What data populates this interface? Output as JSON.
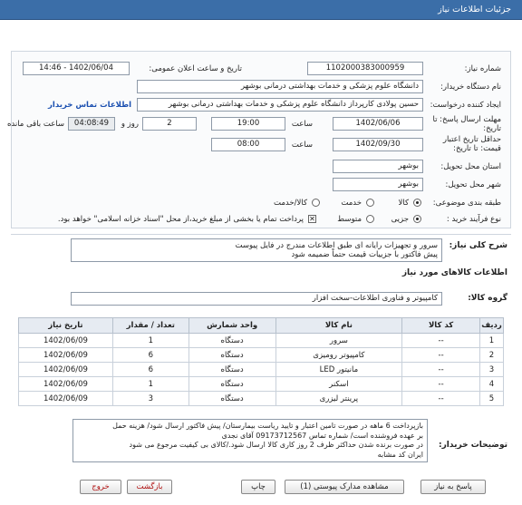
{
  "header": {
    "title": "جزئیات اطلاعات نیاز"
  },
  "form": {
    "need_number_label": "شماره نیاز:",
    "need_number": "1102000383000959",
    "announce_label": "تاریخ و ساعت اعلان عمومی:",
    "announce_value": "1402/06/04 - 14:46",
    "buyer_org_label": "نام دستگاه خریدار:",
    "buyer_org": "دانشگاه علوم پزشکی و خدمات بهداشتی درمانی بوشهر",
    "requester_label": "ایجاد کننده درخواست:",
    "requester": "حسین پولادی کارپرداز دانشگاه علوم پزشکی و خدمات بهداشتی درمانی بوشهر",
    "contact_link": "اطلاعات تماس خریدار",
    "deadline_label": "مهلت ارسال پاسخ: تا تاریخ:",
    "deadline_date": "1402/06/06",
    "time_label": "ساعت",
    "deadline_time": "19:00",
    "days_value": "2",
    "days_label": "روز و",
    "remaining_time": "04:08:49",
    "remaining_label": "ساعت باقی مانده",
    "validity_label": "حداقل تاریخ اعتبار قیمت: تا تاریخ:",
    "validity_date": "1402/09/30",
    "validity_time": "08:00",
    "province_label": "استان محل تحویل:",
    "province": "بوشهر",
    "city_label": "شهر محل تحویل:",
    "city": "بوشهر",
    "category_label": "طبقه بندی موضوعی:",
    "category_options": [
      "کالا",
      "خدمت",
      "کالا/خدمت"
    ],
    "process_label": "نوع فرآیند خرید :",
    "process_options": [
      "جزیی",
      "متوسط"
    ],
    "payment_note": "پرداخت تمام یا بخشی از مبلغ خرید،از محل \"اسناد خزانه اسلامی\" خواهد بود."
  },
  "need_desc": {
    "label": "شرح کلی نیاز:",
    "lines": [
      "سرور و تجهیزات رایانه ای طبق اطلاعات مندرج در فایل پیوست",
      "پیش فاکتور با جزییات قیمت حتماً ضمیمه شود"
    ]
  },
  "goods": {
    "title": "اطلاعات کالاهای مورد نیاز",
    "group_label": "گروه کالا:",
    "group_value": "کامپیوتر و فناوری اطلاعات-سخت افزار",
    "columns": [
      "ردیف",
      "کد کالا",
      "نام کالا",
      "واحد شمارش",
      "تعداد / مقدار",
      "تاریخ نیاز"
    ],
    "rows": [
      [
        "1",
        "--",
        "سرور",
        "دستگاه",
        "1",
        "1402/06/09"
      ],
      [
        "2",
        "--",
        "کامپیوتر رومیزی",
        "دستگاه",
        "6",
        "1402/06/09"
      ],
      [
        "3",
        "--",
        "مانیتور LED",
        "دستگاه",
        "6",
        "1402/06/09"
      ],
      [
        "4",
        "--",
        "اسکنر",
        "دستگاه",
        "1",
        "1402/06/09"
      ],
      [
        "5",
        "--",
        "پرینتر لیزری",
        "دستگاه",
        "3",
        "1402/06/09"
      ]
    ]
  },
  "buyer_notes": {
    "label": "توضیحات خریدار:",
    "lines": [
      "بازپرداخت 6 ماهه در صورت تامین اعتبار و تایید ریاست بیمارستان/ پیش فاکتور ارسال شود/ هزینه حمل",
      "بر عهده فروشنده است/ شماره تماس 09173712567 آقای نجدی",
      "در صورت برنده شدن حداکثر ظرف 2 روز کاری کالا ارسال شود./کالای بی کیفیت مرجوع می شود",
      "ایران کد مشابه"
    ]
  },
  "buttons": {
    "reply": "پاسخ به نیاز",
    "attachments": "مشاهده مدارک پیوستی (1)",
    "print": "چاپ",
    "back": "بازگشت",
    "exit": "خروج"
  }
}
